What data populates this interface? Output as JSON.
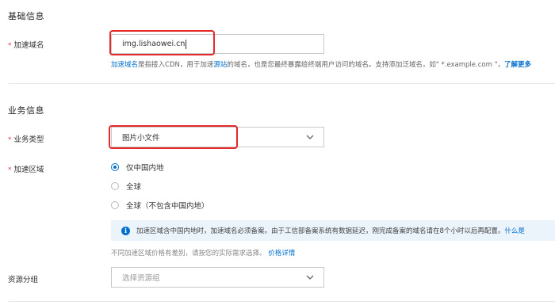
{
  "basic_section": {
    "title": "基础信息"
  },
  "domain_field": {
    "required_mark": "*",
    "label": "加速域名",
    "value": "img.lishaowei.cn",
    "help_link_term": "加速域名",
    "help_text_1": "是指接入CDN，用于加速",
    "help_link_origin": "源站",
    "help_text_2": "的域名，也是您最终暴露给终端用户访问的域名。支持添加泛域名，如\" *.example.com \"，",
    "help_learn_more": "了解更多"
  },
  "business_section": {
    "title": "业务信息"
  },
  "business_type_field": {
    "required_mark": "*",
    "label": "业务类型",
    "selected": "图片小文件",
    "chevron_icon": "chevron-down-icon"
  },
  "region_field": {
    "required_mark": "*",
    "label": "加速区域",
    "options": [
      {
        "label": "仅中国内地",
        "checked": true
      },
      {
        "label": "全球",
        "checked": false
      },
      {
        "label": "全球（不包含中国内地）",
        "checked": false
      }
    ],
    "notice_icon": "info-icon",
    "notice_text": "加速区域含中国内地时，加速域名必须备案。由于工信部备案系统有数据延迟，刚完成备案的域名请在8个小时以后再配置。",
    "notice_link": "什么是",
    "price_note": "不同加速区域价格有差别，请按您的实际需求选择。",
    "price_link": "价格详情"
  },
  "resource_group_field": {
    "label": "资源分组",
    "placeholder": "选择资源组",
    "chevron_icon": "chevron-down-icon"
  },
  "colors": {
    "link": "#0070cc",
    "highlight": "#e5282a",
    "required": "#e5424d",
    "notice_bg": "#ebf3fb"
  }
}
